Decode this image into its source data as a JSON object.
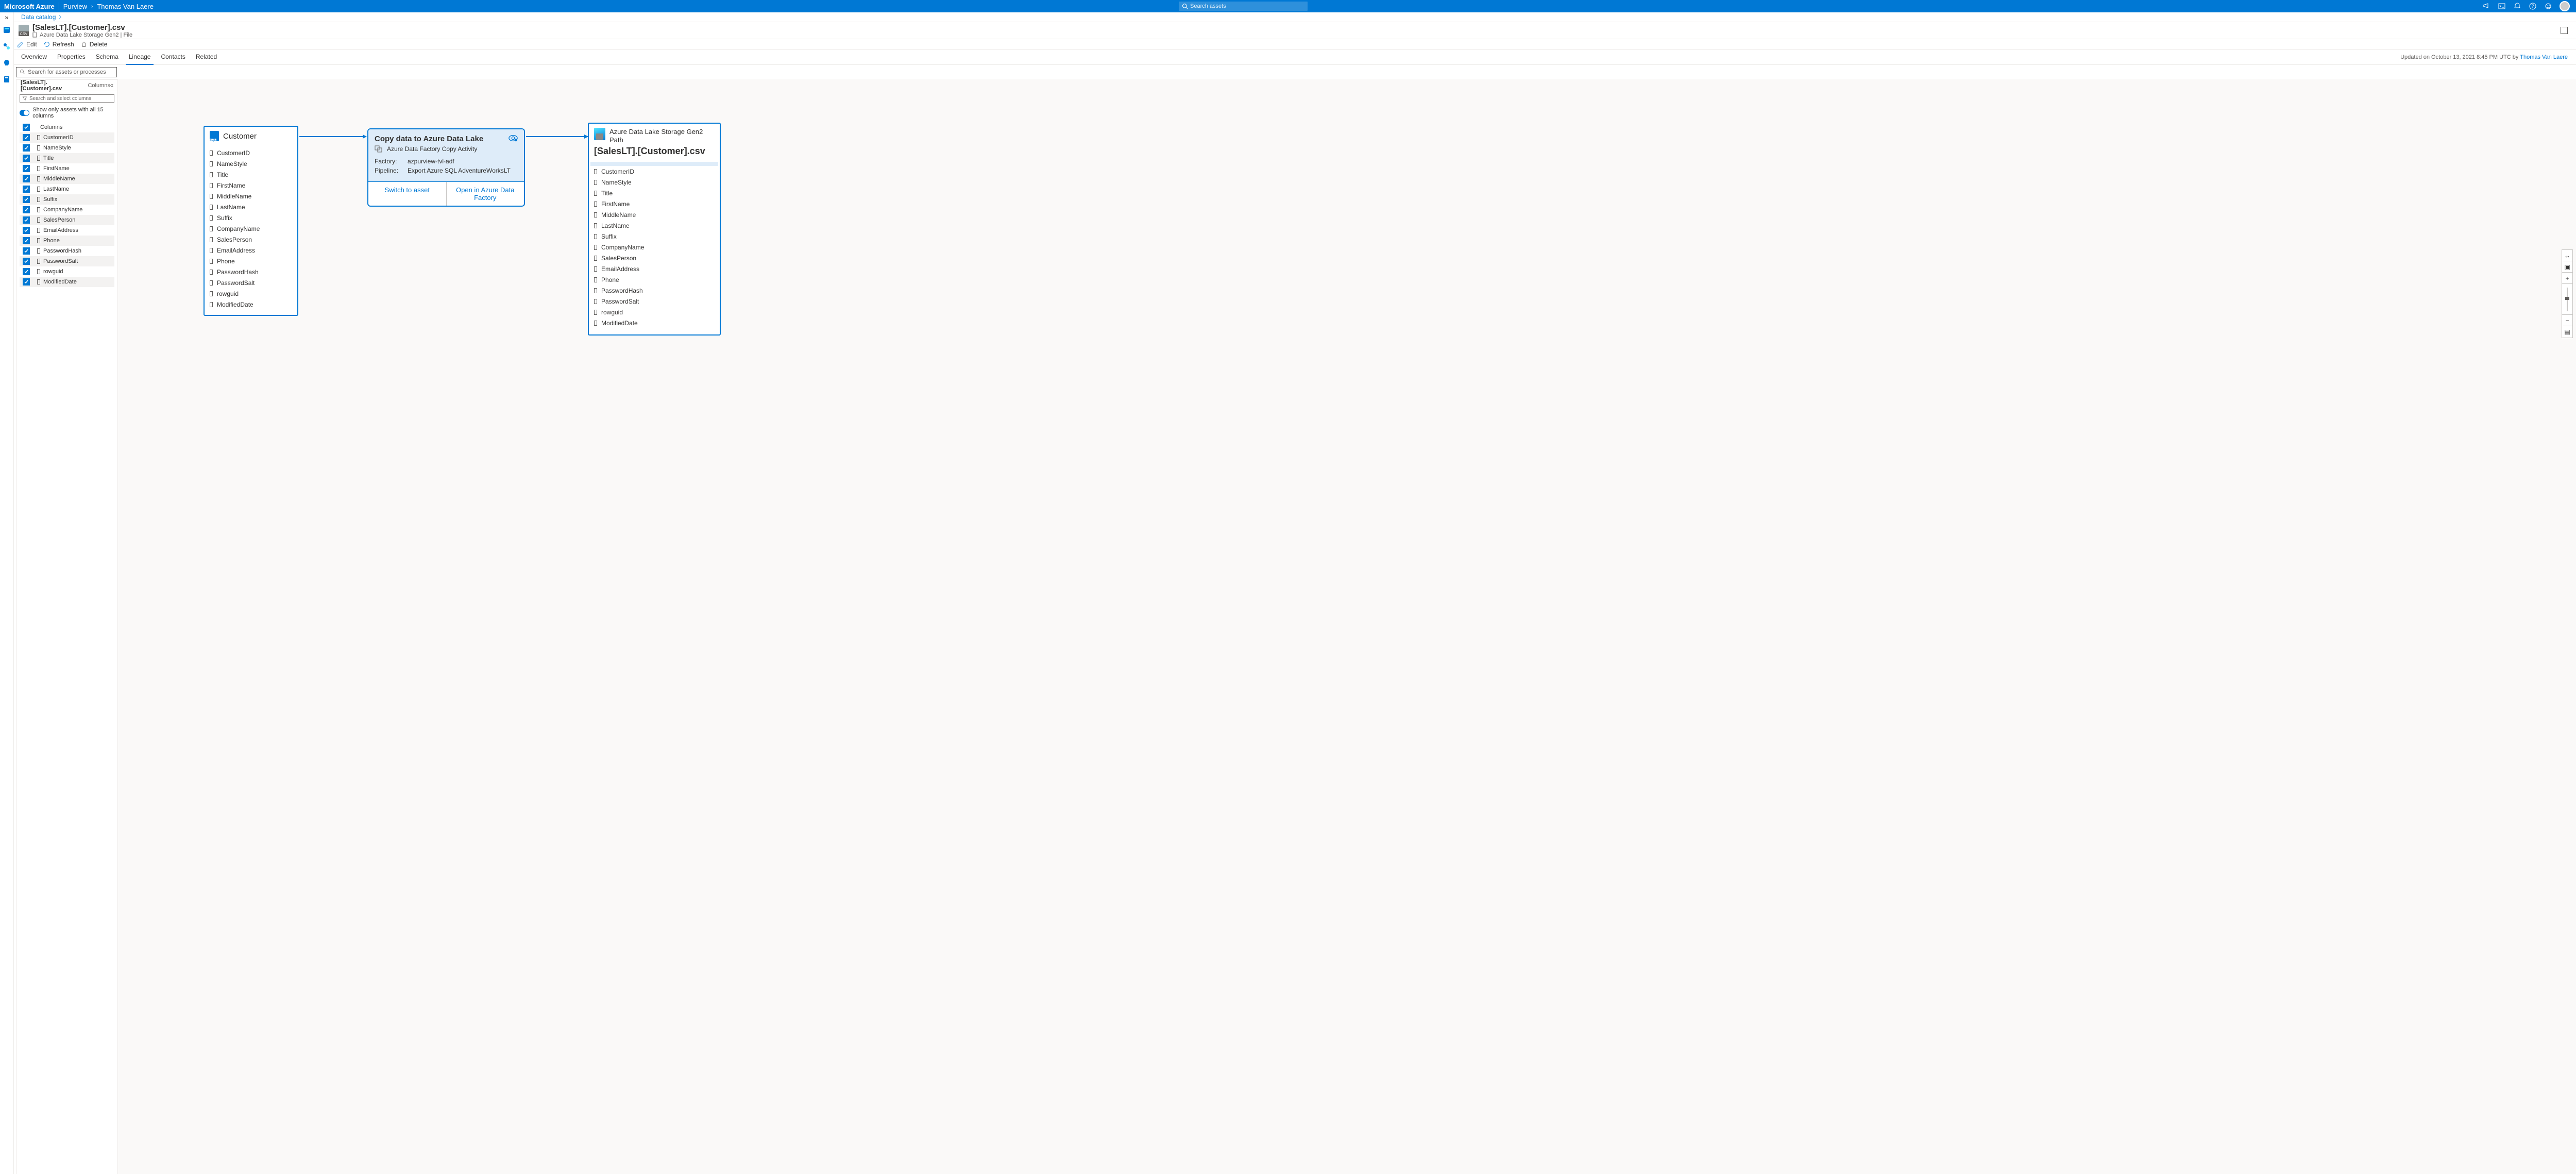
{
  "header": {
    "brand": "Microsoft Azure",
    "service": "Purview",
    "breadcrumb_sep": "›",
    "user_name": "Thomas Van Laere",
    "search_placeholder": "Search assets"
  },
  "breadcrumb": {
    "link": "Data catalog"
  },
  "asset": {
    "title": "[SalesLT].[Customer].csv",
    "subtitle": "Azure Data Lake Storage Gen2 | File"
  },
  "commands": {
    "edit": "Edit",
    "refresh": "Refresh",
    "delete": "Delete"
  },
  "tabs": {
    "overview": "Overview",
    "properties": "Properties",
    "schema": "Schema",
    "lineage": "Lineage",
    "contacts": "Contacts",
    "related": "Related"
  },
  "updated": {
    "prefix": "Updated on October 13, 2021 8:45 PM UTC by ",
    "by": "Thomas Van Laere"
  },
  "asset_search": {
    "placeholder": "Search for assets or processes"
  },
  "col_panel": {
    "file": "[SalesLT].[Customer].csv",
    "label": "Columns",
    "filter_placeholder": "Search and select columns",
    "toggle_label": "Show only assets with all 15 columns",
    "group": "Columns",
    "items": [
      "CustomerID",
      "NameStyle",
      "Title",
      "FirstName",
      "MiddleName",
      "LastName",
      "Suffix",
      "CompanyName",
      "SalesPerson",
      "EmailAddress",
      "Phone",
      "PasswordHash",
      "PasswordSalt",
      "rowguid",
      "ModifiedDate"
    ]
  },
  "lineage": {
    "source": {
      "title": "Customer",
      "columns": [
        "CustomerID",
        "NameStyle",
        "Title",
        "FirstName",
        "MiddleName",
        "LastName",
        "Suffix",
        "CompanyName",
        "SalesPerson",
        "EmailAddress",
        "Phone",
        "PasswordHash",
        "PasswordSalt",
        "rowguid",
        "ModifiedDate"
      ]
    },
    "activity": {
      "title": "Copy data to Azure Data Lake",
      "subtitle": "Azure Data Factory Copy Activity",
      "factory_label": "Factory:",
      "factory_value": "azpurview-tvl-adf",
      "pipeline_label": "Pipeline:",
      "pipeline_value": "Export Azure SQL AdventureWorksLT",
      "btn_switch": "Switch to asset",
      "btn_open": "Open in Azure Data Factory"
    },
    "dest": {
      "path_line1": "Azure Data Lake Storage Gen2",
      "path_line2": "Path",
      "file": "[SalesLT].[Customer].csv",
      "columns": [
        "CustomerID",
        "NameStyle",
        "Title",
        "FirstName",
        "MiddleName",
        "LastName",
        "Suffix",
        "CompanyName",
        "SalesPerson",
        "EmailAddress",
        "Phone",
        "PasswordHash",
        "PasswordSalt",
        "rowguid",
        "ModifiedDate"
      ]
    }
  }
}
